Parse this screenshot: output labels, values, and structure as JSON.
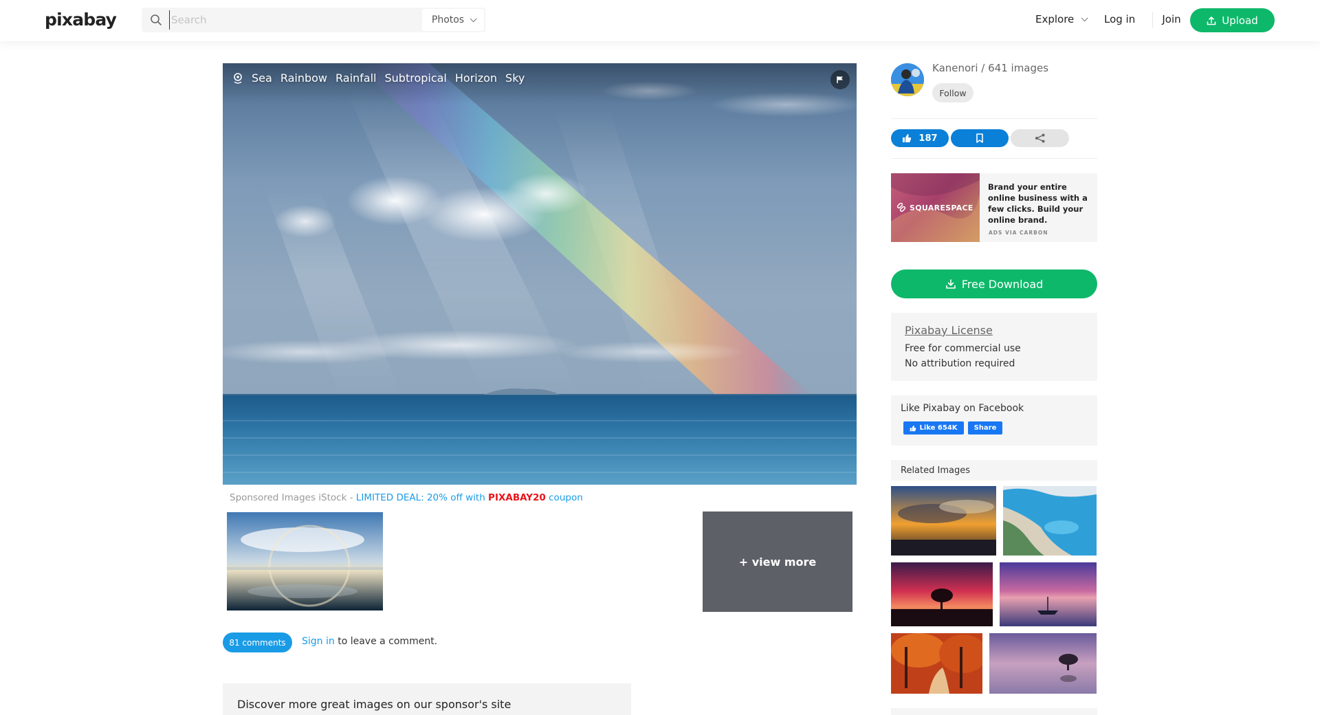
{
  "header": {
    "logo": "pixabay",
    "search_placeholder": "Search",
    "search_type": "Photos",
    "nav": {
      "explore": "Explore",
      "login": "Log in",
      "join": "Join",
      "upload": "Upload"
    }
  },
  "image": {
    "tags": [
      "Sea",
      "Rainbow",
      "Rainfall",
      "Subtropical",
      "Horizon",
      "Sky"
    ]
  },
  "sponsored": {
    "prefix": "Sponsored Images iStock - ",
    "deal": "LIMITED DEAL: 20% off with ",
    "code": "PIXABAY20",
    "suffix": " coupon",
    "view_more": "+ view more"
  },
  "comments": {
    "count_label": "81 comments",
    "sign_in": "Sign in",
    "sign_in_suffix": " to leave a comment."
  },
  "discover": {
    "text": "Discover more great images on our sponsor's site"
  },
  "author": {
    "name": "Kanenori",
    "separator": " / ",
    "images": "641 images",
    "follow": "Follow"
  },
  "actions": {
    "likes": "187"
  },
  "ad": {
    "brand": "SQUARESPACE",
    "text": "Brand your entire online business with a few clicks. Build your online brand.",
    "via": "ADS VIA CARBON"
  },
  "download": {
    "label": "Free Download"
  },
  "license": {
    "title": "Pixabay License",
    "line1": "Free for commercial use",
    "line2": "No attribution required"
  },
  "facebook": {
    "title": "Like Pixabay on Facebook",
    "like": "Like 654K",
    "share": "Share"
  },
  "related": {
    "title": "Related Images"
  },
  "colors": {
    "green": "#0eb86a",
    "blue": "#0a80d8",
    "link": "#1a9be6",
    "coupon": "#e8151b"
  }
}
